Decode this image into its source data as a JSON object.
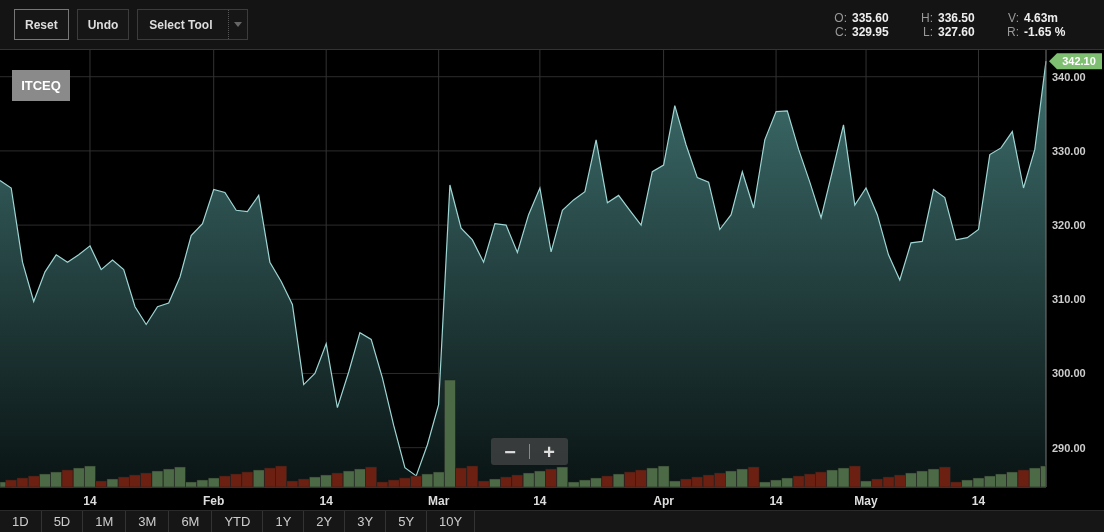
{
  "toolbar": {
    "buttons": [
      {
        "label": "Reset",
        "kind": "button"
      },
      {
        "label": "Undo",
        "kind": "button"
      },
      {
        "label": "Select Tool",
        "kind": "dropdown"
      }
    ]
  },
  "quote": [
    {
      "label": "O:",
      "value": "335.60"
    },
    {
      "label": "C:",
      "value": "329.95"
    },
    {
      "label": "H:",
      "value": "336.50"
    },
    {
      "label": "L:",
      "value": "327.60"
    },
    {
      "label": "V:",
      "value": "4.63m"
    },
    {
      "label": "R:",
      "value": "-1.65 %"
    }
  ],
  "chart": {
    "symbol": "ITCEQ",
    "last_price": "342.10",
    "zoom_buttons": [
      "−",
      "+"
    ],
    "chart_data": {
      "type": "area",
      "values": [
        326,
        325,
        315,
        309.7,
        313.7,
        316,
        315,
        316,
        317.2,
        314,
        315.3,
        314,
        309,
        306.6,
        309,
        309.5,
        313,
        318.6,
        320.2,
        324.8,
        324.4,
        322,
        321.8,
        324,
        315,
        312.4,
        309.3,
        298.5,
        300,
        304,
        295.4,
        300.2,
        305.5,
        304.6,
        299.4,
        293,
        287.3,
        286.2,
        290.4,
        295.8,
        325.4,
        319.6,
        318,
        315,
        320.2,
        320,
        316.3,
        321.4,
        325,
        316.4,
        322,
        323.4,
        324.5,
        331.5,
        323,
        324,
        322,
        320,
        327.2,
        328.1,
        336.1,
        330.8,
        326.4,
        325.8,
        319.4,
        321.4,
        327.2,
        322.3,
        331.5,
        335.3,
        335.4,
        330.2,
        325.8,
        321,
        327.2,
        333.5,
        322.7,
        325,
        321.4,
        316,
        312.6,
        317.6,
        317.8,
        324.8,
        323.7,
        318,
        318.3,
        319.4,
        329.5,
        330.4,
        332.6,
        325,
        330.2,
        342.1
      ],
      "categories": [
        null,
        null,
        null,
        null,
        null,
        null,
        null,
        null,
        "14",
        null,
        null,
        null,
        null,
        null,
        null,
        null,
        null,
        null,
        null,
        "Feb",
        null,
        null,
        null,
        null,
        null,
        null,
        null,
        null,
        null,
        "14",
        null,
        null,
        null,
        null,
        null,
        null,
        null,
        null,
        null,
        "Mar",
        null,
        null,
        null,
        null,
        null,
        null,
        null,
        null,
        "14",
        null,
        null,
        null,
        null,
        null,
        null,
        null,
        null,
        null,
        null,
        "Apr",
        null,
        null,
        null,
        null,
        null,
        null,
        null,
        null,
        null,
        "14",
        null,
        null,
        null,
        null,
        null,
        null,
        null,
        "May",
        null,
        null,
        null,
        null,
        null,
        null,
        null,
        null,
        null,
        "14",
        null,
        null,
        null,
        null,
        null,
        null
      ],
      "grid": true,
      "ylim": [
        284.7,
        343.6
      ],
      "yticks": [
        {
          "value": 290,
          "label": "290.00"
        },
        {
          "value": 300,
          "label": "300.00"
        },
        {
          "value": 310,
          "label": "310.00"
        },
        {
          "value": 320,
          "label": "320.00"
        },
        {
          "value": 330,
          "label": "330.00"
        },
        {
          "value": 340,
          "label": "340.00"
        }
      ]
    }
  },
  "ranges": [
    "1D",
    "5D",
    "1M",
    "3M",
    "6M",
    "YTD",
    "1Y",
    "2Y",
    "3Y",
    "5Y",
    "10Y"
  ]
}
